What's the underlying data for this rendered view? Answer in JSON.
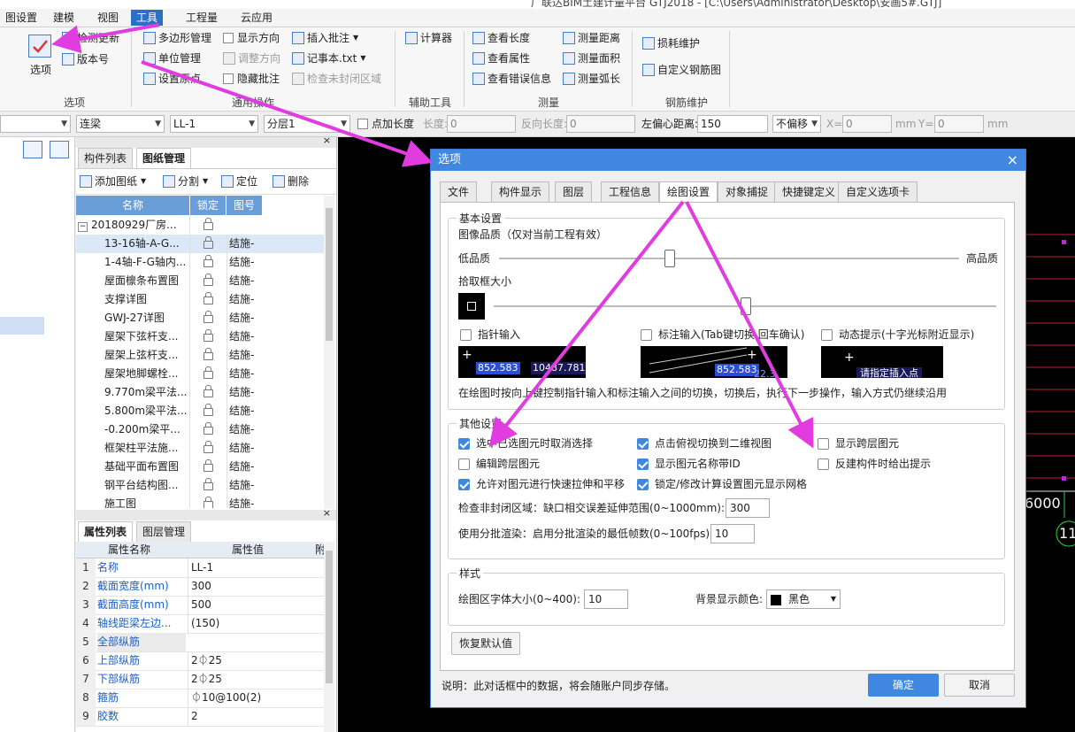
{
  "window": {
    "title_fragment": "广联达BIM土建计量平台 GTJ2018 - [C:\\Users\\Administrator\\Desktop\\安画5#.GTJ]"
  },
  "menu": {
    "items": [
      "图设置",
      "建模",
      "视图",
      "工具",
      "工程量",
      "云应用"
    ],
    "active_index": 3
  },
  "ribbon": {
    "options_group": {
      "options_button": "选项",
      "check_update": "检测更新",
      "version": "版本号",
      "label": "选项"
    },
    "general_group": {
      "polygon": "多边形管理",
      "unit": "单位管理",
      "origin": "设置原点",
      "show_direction": "显示方向",
      "adjust_direction": "调整方向",
      "hide_annotation": "隐藏批注",
      "insert_annotation": "插入批注",
      "notepad": "记事本.txt",
      "check_unclosed": "检查未封闭区域",
      "label": "通用操作"
    },
    "aux_group": {
      "calculator": "计算器",
      "label": "辅助工具"
    },
    "measure_group": {
      "view_length": "查看长度",
      "view_attr": "查看属性",
      "view_errors": "查看错误信息",
      "measure_distance": "测量距离",
      "measure_area": "测量面积",
      "measure_arc": "测量弧长",
      "label": "测量"
    },
    "rebar_group": {
      "loss": "损耗维护",
      "custom_rebar": "自定义钢筋图",
      "label": "钢筋维护"
    }
  },
  "toolbar": {
    "combo1": "",
    "combo2": "连梁",
    "combo3": "LL-1",
    "combo4": "分层1",
    "point_length": "点加长度",
    "length_label": "长度:",
    "length_value": "0",
    "reverse_label": "反向长度:",
    "reverse_value": "0",
    "offset_label": "左偏心距离:",
    "offset_value": "150",
    "no_offset": "不偏移",
    "x_label": "X=",
    "x_value": "0",
    "mm1": "mm",
    "y_label": "Y=",
    "y_value": "0",
    "mm2": "mm"
  },
  "drawing_panel": {
    "tabs": [
      "构件列表",
      "图纸管理"
    ],
    "actions": {
      "add": "添加图纸",
      "split": "分割",
      "locate": "定位",
      "delete": "删除"
    },
    "columns": [
      "名称",
      "锁定",
      "图号"
    ],
    "rows": [
      {
        "name": "20180929厂房...",
        "num": ""
      },
      {
        "name": "13-16轴-A-G...",
        "num": "结施-"
      },
      {
        "name": "1-4轴-F-G轴内...",
        "num": "结施-"
      },
      {
        "name": "屋面檩条布置图",
        "num": "结施-"
      },
      {
        "name": "支撑详图",
        "num": "结施-"
      },
      {
        "name": "GWJ-27详图",
        "num": "结施-"
      },
      {
        "name": "屋架下弦杆支...",
        "num": "结施-"
      },
      {
        "name": "屋架上弦杆支...",
        "num": "结施-"
      },
      {
        "name": "屋架地脚螺栓...",
        "num": "结施-"
      },
      {
        "name": "9.770m梁平法...",
        "num": "结施-"
      },
      {
        "name": "5.800m梁平法...",
        "num": "结施-"
      },
      {
        "name": "-0.200m梁平...",
        "num": "结施-"
      },
      {
        "name": "框架柱平法施...",
        "num": "结施-"
      },
      {
        "name": "基础平面布置图",
        "num": "结施-"
      },
      {
        "name": "钢平台结构图...",
        "num": "结施-"
      },
      {
        "name": "施工图",
        "num": "结施-"
      }
    ]
  },
  "prop_panel": {
    "tabs": [
      "属性列表",
      "图层管理"
    ],
    "columns": [
      "属性名称",
      "属性值",
      "附"
    ],
    "rows": [
      {
        "n": "1",
        "k": "名称",
        "v": "LL-1"
      },
      {
        "n": "2",
        "k": "截面宽度(mm)",
        "v": "300"
      },
      {
        "n": "3",
        "k": "截面高度(mm)",
        "v": "500"
      },
      {
        "n": "4",
        "k": "轴线距梁左边...",
        "v": "(150)"
      },
      {
        "n": "5",
        "k": "全部纵筋",
        "v": ""
      },
      {
        "n": "6",
        "k": "上部纵筋",
        "v": "2⏀25"
      },
      {
        "n": "7",
        "k": "下部纵筋",
        "v": "2⏀25"
      },
      {
        "n": "8",
        "k": "箍筋",
        "v": "⏀10@100(2)"
      },
      {
        "n": "9",
        "k": "胶数",
        "v": "2"
      }
    ]
  },
  "canvas": {
    "label_6000": "6000",
    "label_11": "11"
  },
  "dialog": {
    "title": "选项",
    "close": "×",
    "tabs": [
      "文件",
      "构件显示",
      "图层",
      "工程信息",
      "绘图设置",
      "对象捕捉",
      "快捷键定义",
      "自定义选项卡"
    ],
    "active_tab": 4,
    "basic": {
      "title": "基本设置",
      "quality_title": "图像品质（仅对当前工程有效）",
      "quality_low": "低品质",
      "quality_high": "高品质",
      "quality_level": 0.37,
      "pick_title": "拾取框大小",
      "pick_level": 0.5,
      "pointer_input": "指针输入",
      "dimension_input": "标注输入(Tab键切换,回车确认)",
      "dynamic_hint": "动态提示(十字光标附近显示)",
      "preview1_a": "852.583",
      "preview1_b": "10487.781",
      "preview2_a": "852.583",
      "preview2_b": "22.3",
      "preview3": "请指定插入点",
      "note": "在绘图时按向上键控制指针输入和标注输入之间的切换，切换后，执行下一步操作，输入方式仍继续沿用"
    },
    "other": {
      "title": "其他设置",
      "opt1": "选中已选图元时取消选择",
      "opt1_checked": true,
      "opt2": "点击俯视切换到二维视图",
      "opt2_checked": true,
      "opt3": "显示跨层图元",
      "opt3_checked": false,
      "opt4": "编辑跨层图元",
      "opt4_checked": false,
      "opt5": "显示图元名称带ID",
      "opt5_checked": true,
      "opt6": "反建构件时给出提示",
      "opt6_checked": false,
      "opt7": "允许对图元进行快速拉伸和平移",
      "opt7_checked": true,
      "opt8": "锁定/修改计算设置图元显示网格",
      "opt8_checked": true,
      "check_label": "检查非封闭区域：缺口相交误差延伸范围(0~1000mm):",
      "check_value": "300",
      "batch_label": "使用分批渲染：启用分批渲染的最低帧数(0~100fps):",
      "batch_value": "10"
    },
    "style": {
      "title": "样式",
      "font_label": "绘图区字体大小(0~400):",
      "font_value": "10",
      "bg_label": "背景显示颜色:",
      "bg_value": "黑色",
      "bg_color": "#000000"
    },
    "restore": "恢复默认值",
    "footer_note": "说明：此对话框中的数据，将会随账户同步存储。",
    "ok": "确定",
    "cancel": "取消"
  },
  "colors": {
    "accent": "#3f87e0",
    "arrow": "#e03ce0",
    "grid_red": "#c0203a"
  }
}
